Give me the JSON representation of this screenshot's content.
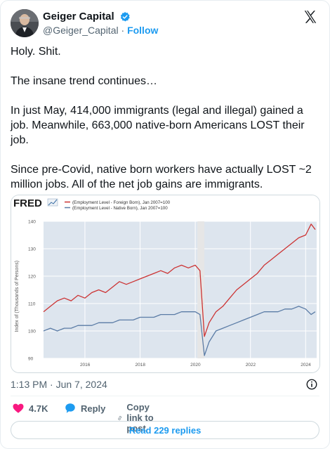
{
  "author": {
    "display_name": "Geiger Capital",
    "handle": "@Geiger_Capital",
    "separator": "·",
    "follow_label": "Follow"
  },
  "tweet": {
    "text": "Holy. Shit.\n\nThe insane trend continues…\n\nIn just May, 414,000 immigrants (legal and illegal) gained a job. Meanwhile, 663,000 native-born Americans LOST their job.\n\nSince pre-Covid, native born workers have actually LOST ~2 million jobs. All of the net job gains are immigrants."
  },
  "chart_data": {
    "type": "line",
    "title": "",
    "source_logo": "FRED",
    "xlabel": "",
    "ylabel": "Index of (Thousands of Persons)",
    "ylim": [
      90,
      140
    ],
    "xlim": [
      2014.5,
      2024.4
    ],
    "x_ticks": [
      "2016",
      "2018",
      "2020",
      "2022",
      "2024"
    ],
    "y_ticks": [
      "90",
      "100",
      "110",
      "120",
      "130",
      "140"
    ],
    "recession_band": [
      2020.08,
      2020.33
    ],
    "series": [
      {
        "name": "(Employment Level - Foreign Born), Jan 2007=100",
        "color": "#cc3333",
        "x": [
          2014.5,
          2014.75,
          2015.0,
          2015.25,
          2015.5,
          2015.75,
          2016.0,
          2016.25,
          2016.5,
          2016.75,
          2017.0,
          2017.25,
          2017.5,
          2017.75,
          2018.0,
          2018.25,
          2018.5,
          2018.75,
          2019.0,
          2019.25,
          2019.5,
          2019.75,
          2020.0,
          2020.17,
          2020.33,
          2020.5,
          2020.75,
          2021.0,
          2021.25,
          2021.5,
          2021.75,
          2022.0,
          2022.25,
          2022.5,
          2022.75,
          2023.0,
          2023.25,
          2023.5,
          2023.75,
          2024.0,
          2024.2,
          2024.35
        ],
        "values": [
          107,
          109,
          111,
          112,
          111,
          113,
          112,
          114,
          115,
          114,
          116,
          118,
          117,
          118,
          119,
          120,
          121,
          122,
          121,
          123,
          124,
          123,
          124,
          122,
          98,
          103,
          107,
          109,
          112,
          115,
          117,
          119,
          121,
          124,
          126,
          128,
          130,
          132,
          134,
          135,
          139,
          137
        ]
      },
      {
        "name": "(Employment Level - Native Born), Jan 2007=100",
        "color": "#5b7ca6",
        "x": [
          2014.5,
          2014.75,
          2015.0,
          2015.25,
          2015.5,
          2015.75,
          2016.0,
          2016.25,
          2016.5,
          2016.75,
          2017.0,
          2017.25,
          2017.5,
          2017.75,
          2018.0,
          2018.25,
          2018.5,
          2018.75,
          2019.0,
          2019.25,
          2019.5,
          2019.75,
          2020.0,
          2020.17,
          2020.33,
          2020.5,
          2020.75,
          2021.0,
          2021.25,
          2021.5,
          2021.75,
          2022.0,
          2022.25,
          2022.5,
          2022.75,
          2023.0,
          2023.25,
          2023.5,
          2023.75,
          2024.0,
          2024.2,
          2024.35
        ],
        "values": [
          100,
          101,
          100,
          101,
          101,
          102,
          102,
          102,
          103,
          103,
          103,
          104,
          104,
          104,
          105,
          105,
          105,
          106,
          106,
          106,
          107,
          107,
          107,
          106,
          91,
          96,
          100,
          101,
          102,
          103,
          104,
          105,
          106,
          107,
          107,
          107,
          108,
          108,
          109,
          108,
          106,
          107
        ]
      }
    ]
  },
  "meta": {
    "time": "1:13 PM",
    "separator": "·",
    "date": "Jun 7, 2024"
  },
  "actions": {
    "like_count": "4.7K",
    "reply_label": "Reply",
    "copy_label": "Copy link to post",
    "read_replies_label": "Read 229 replies"
  },
  "colors": {
    "accent": "#1d9bf0",
    "like": "#f91880",
    "verified": "#1d9bf0"
  },
  "icons": {
    "verified": "verified-badge-icon",
    "x_logo": "x-logo-icon",
    "info": "info-icon",
    "like": "heart-icon",
    "reply": "speech-bubble-icon",
    "copy": "link-icon"
  }
}
